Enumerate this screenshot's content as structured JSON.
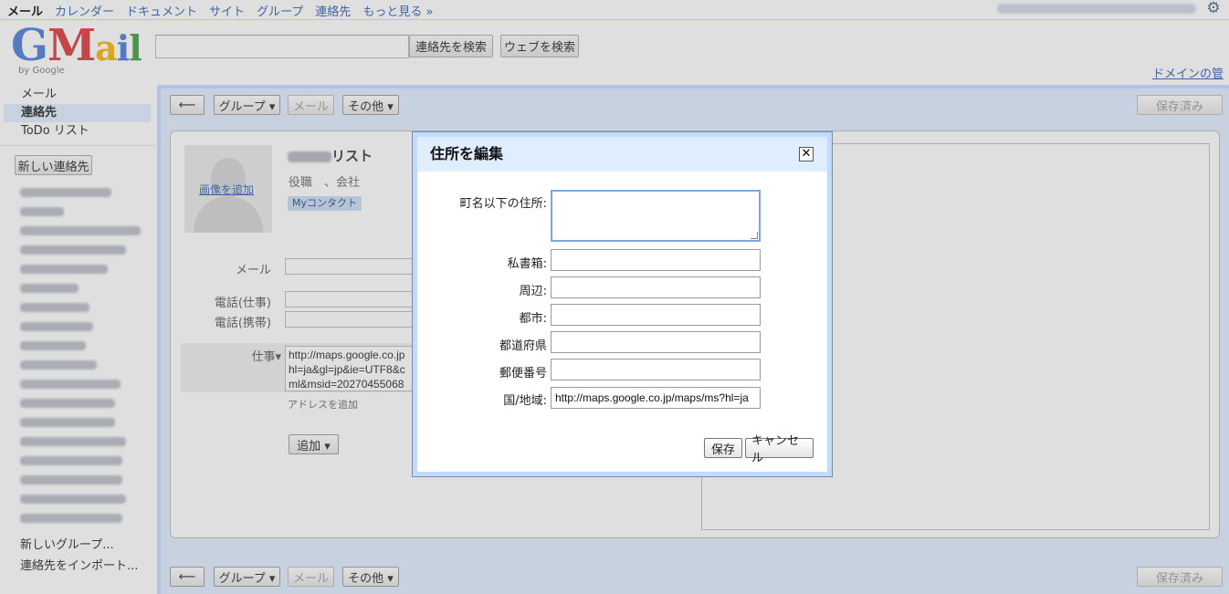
{
  "topnav": {
    "items": [
      "メール",
      "カレンダー",
      "ドキュメント",
      "サイト",
      "グループ",
      "連絡先",
      "もっと見る »"
    ],
    "current_index": 0
  },
  "logo": {
    "text": "GMail",
    "byline": "by Google"
  },
  "search": {
    "value": "",
    "contacts_button": "連絡先を検索",
    "web_button": "ウェブを検索"
  },
  "domain_link": "ドメインの管理",
  "sidebar": {
    "items": [
      {
        "label": "メール",
        "selected": false
      },
      {
        "label": "連絡先",
        "selected": true
      },
      {
        "label": "ToDo リスト",
        "selected": false
      }
    ],
    "new_contact_button": "新しい連絡先",
    "new_group_link": "新しいグループ...",
    "import_link": "連絡先をインポート..."
  },
  "toolbar": {
    "back_label": "⟵",
    "group_label": "グループ ▾",
    "mail_label": "メール",
    "more_label": "その他 ▾",
    "saved_label": "保存済み"
  },
  "contact": {
    "photo_link": "画像を追加",
    "name_suffix": "リスト",
    "role_company": "役職　、会社",
    "group_tag": "Myコンタクト",
    "email_label": "メール",
    "phone_work_label": "電話(仕事)",
    "phone_mobile_label": "電話(携帯)",
    "address_label": "仕事▾",
    "address_text": "http://maps.google.co.jp\nhl=ja&gl=jp&ie=UTF8&c\nml&msid=20270455068",
    "add_address_link": "アドレスを追加",
    "add_button": "追加 ▾"
  },
  "dialog": {
    "title": "住所を編集",
    "close_label": "✕",
    "fields": {
      "street_label": "町名以下の住所:",
      "street_value": "",
      "pobox_label": "私書箱:",
      "pobox_value": "",
      "neighborhood_label": "周辺:",
      "neighborhood_value": "",
      "city_label": "都市:",
      "city_value": "",
      "region_label": "都道府県",
      "region_value": "",
      "postcode_label": "郵便番号",
      "postcode_value": "",
      "country_label": "国/地域:",
      "country_value": "http://maps.google.co.jp/maps/ms?hl=ja"
    },
    "save_button": "保存",
    "cancel_button": "キャンセル"
  },
  "colors": {
    "accent": "#c3d9ff",
    "panel": "#e0ecff",
    "link": "#2a5db0"
  }
}
